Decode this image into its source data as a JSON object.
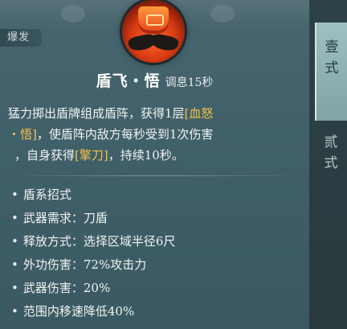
{
  "tooltip": {
    "tag": "爆发",
    "skill_name": "盾飞・悟",
    "cooldown": "调息15秒",
    "description": {
      "line1_before": "猛力掷出盾牌组成盾阵，获得1层",
      "buff_name_part1": "[血怒",
      "buff_name_part2": "・悟]",
      "line2_after": "，使盾阵内敌方每秒受到1次伤害",
      "line3_before": "，自身获得",
      "buff2_name": "[擎刀]",
      "line3_after": "，持续10秒。"
    },
    "stats": [
      "盾系招式",
      "武器需求：刀盾",
      "释放方式：选择区域半径6尺",
      "外功伤害：72%攻击力",
      "武器伤害：20%",
      "范围内移速降低40%"
    ],
    "highlight_color": "#f5c14a"
  },
  "side_tabs": [
    {
      "char1": "壹",
      "char2": "式",
      "active": true
    },
    {
      "char1": "贰",
      "char2": "式",
      "active": false
    }
  ],
  "icons": {
    "skill": "shield-skill-icon"
  }
}
